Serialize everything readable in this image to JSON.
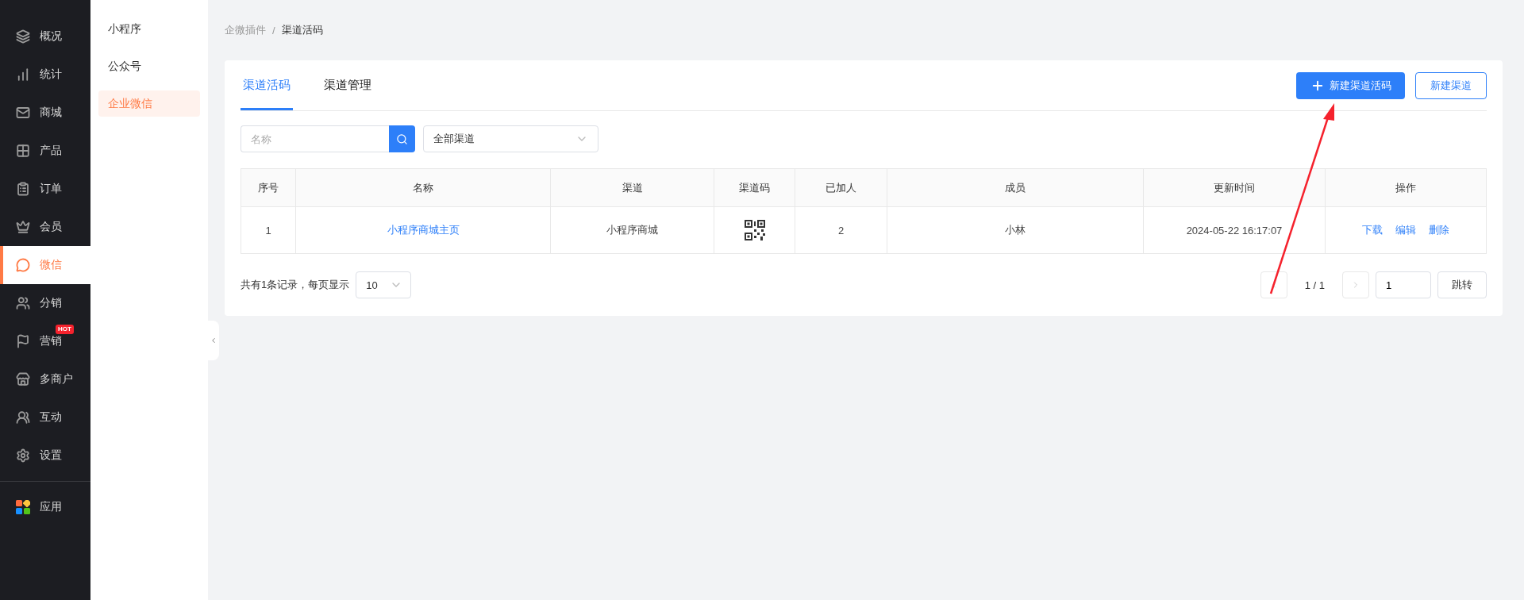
{
  "sidebar": {
    "items": [
      {
        "label": "概况",
        "selected": false
      },
      {
        "label": "统计",
        "selected": false
      },
      {
        "label": "商城",
        "selected": false
      },
      {
        "label": "产品",
        "selected": false
      },
      {
        "label": "订单",
        "selected": false
      },
      {
        "label": "会员",
        "selected": false
      },
      {
        "label": "微信",
        "selected": true
      },
      {
        "label": "分销",
        "selected": false
      },
      {
        "label": "营销",
        "selected": false,
        "badge": "HOT"
      },
      {
        "label": "多商户",
        "selected": false
      },
      {
        "label": "互动",
        "selected": false
      },
      {
        "label": "设置",
        "selected": false
      }
    ],
    "bottom_items": [
      {
        "label": "应用",
        "selected": false
      }
    ]
  },
  "subnav": {
    "items": [
      {
        "label": "小程序",
        "selected": false
      },
      {
        "label": "公众号",
        "selected": false
      },
      {
        "label": "企业微信",
        "selected": true
      }
    ]
  },
  "breadcrumb": {
    "separator": "/",
    "items": [
      "企微插件",
      "渠道活码"
    ]
  },
  "tabs": [
    {
      "label": "渠道活码",
      "selected": true
    },
    {
      "label": "渠道管理",
      "selected": false
    }
  ],
  "buttons": {
    "primary": "新建渠道活码",
    "secondary": "新建渠道"
  },
  "filters": {
    "search": {
      "placeholder": "名称"
    },
    "channel_select": {
      "value": "全部渠道"
    }
  },
  "table": {
    "columns": [
      "序号",
      "名称",
      "渠道",
      "渠道码",
      "已加人",
      "成员",
      "更新时间",
      "操作"
    ],
    "rows": [
      {
        "index": "1",
        "name": "小程序商城主页",
        "channel": "小程序商城",
        "joined": "2",
        "member": "小林",
        "updated": "2024-05-22 16:17:07",
        "actions": [
          "下载",
          "编辑",
          "删除"
        ]
      }
    ]
  },
  "pagination": {
    "summary": "共有1条记录，每页显示",
    "page_size": "10",
    "page_info": "1 / 1",
    "jump_value": "1",
    "jump_button": "跳转"
  }
}
